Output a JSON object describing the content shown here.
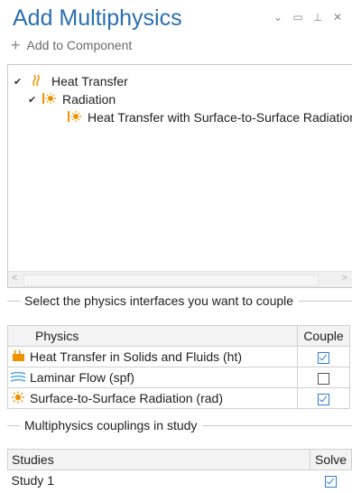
{
  "header": {
    "title": "Add Multiphysics",
    "add_label": "Add to Component"
  },
  "window_controls": [
    "chevron-down",
    "restore",
    "pin",
    "close"
  ],
  "tree": {
    "items": [
      {
        "label": "Heat Transfer",
        "level": 0,
        "expanded": true,
        "icon": "heat-transfer-icon"
      },
      {
        "label": "Radiation",
        "level": 1,
        "expanded": true,
        "icon": "radiation-icon"
      },
      {
        "label": "Heat Transfer with Surface-to-Surface Radiation",
        "level": 2,
        "icon": "radiation-icon"
      }
    ]
  },
  "physics_section": {
    "heading": "Select the physics interfaces you want to couple",
    "col_physics": "Physics",
    "col_couple": "Couple",
    "rows": [
      {
        "label": "Heat Transfer in Solids and Fluids (ht)",
        "checked": true,
        "icon": "heat-transfer-solids-icon"
      },
      {
        "label": "Laminar Flow (spf)",
        "checked": false,
        "icon": "laminar-flow-icon"
      },
      {
        "label": "Surface-to-Surface Radiation (rad)",
        "checked": true,
        "icon": "radiation-icon"
      }
    ]
  },
  "studies_section": {
    "heading": "Multiphysics couplings in study",
    "col_studies": "Studies",
    "col_solve": "Solve",
    "rows": [
      {
        "label": "Study 1",
        "checked": true
      }
    ]
  },
  "colors": {
    "title": "#2a6fb0",
    "accent_orange": "#f29100",
    "checkbox": "#2f7bd8"
  }
}
